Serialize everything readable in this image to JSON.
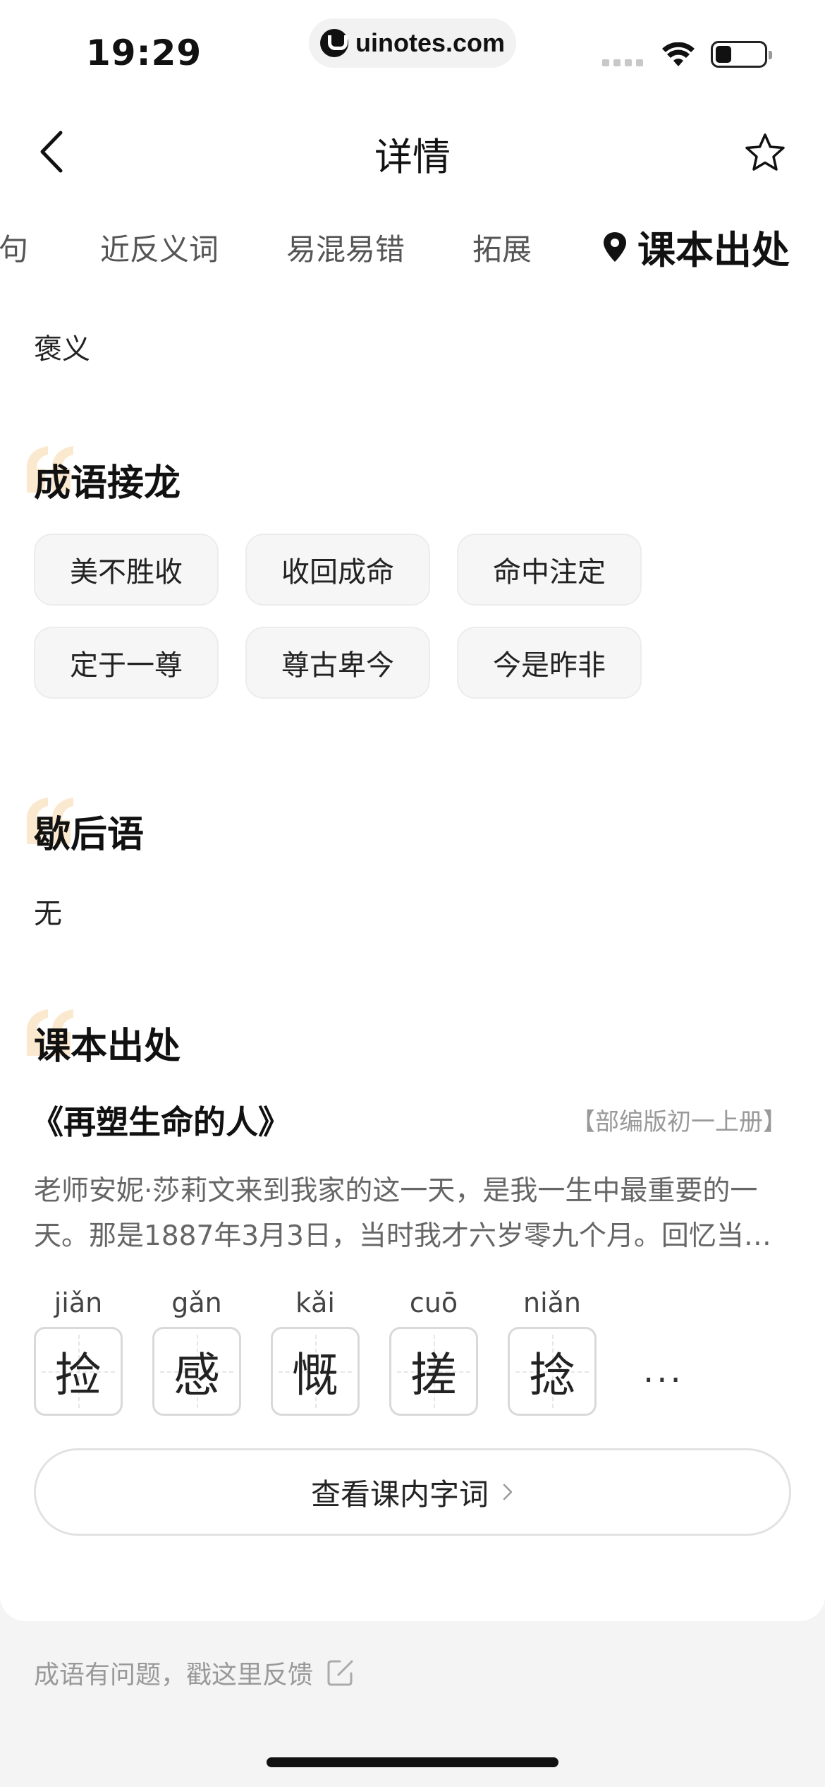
{
  "status_bar": {
    "time": "19:29",
    "url": "uinotes.com"
  },
  "header": {
    "title": "详情",
    "back_icon": "chevron-left-icon",
    "favorite_icon": "star-icon"
  },
  "tabs": [
    {
      "label": "句"
    },
    {
      "label": "近反义词"
    },
    {
      "label": "易混易错"
    },
    {
      "label": "拓展"
    },
    {
      "label": "课本出处",
      "active": true,
      "icon": "location-pin-icon"
    }
  ],
  "usage_value": "褒义",
  "idiom_chain": {
    "title": "成语接龙",
    "items": [
      "美不胜收",
      "收回成命",
      "命中注定",
      "定于一尊",
      "尊古卑今",
      "今是昨非"
    ]
  },
  "xiehouyu": {
    "title": "歇后语",
    "value": "无"
  },
  "textbook_source": {
    "title": "课本出处",
    "lesson_title": "《再塑生命的人》",
    "edition_tag": "【部编版初一上册】",
    "excerpt": "老师安妮·莎莉文来到我家的这一天，是我一生中最重要的一天。那是1887年3月3日，当时我才六岁零九个月。回忆当时的情景，仿佛就在眼前。",
    "characters": [
      {
        "pinyin": "jiǎn",
        "char": "捡"
      },
      {
        "pinyin": "gǎn",
        "char": "感"
      },
      {
        "pinyin": "kǎi",
        "char": "慨"
      },
      {
        "pinyin": "cuō",
        "char": "搓"
      },
      {
        "pinyin": "niǎn",
        "char": "捻"
      }
    ],
    "more": "···",
    "view_button": "查看课内字词"
  },
  "feedback": {
    "text": "成语有问题，戳这里反馈"
  },
  "colors": {
    "accent_deco": "#fbe9cf",
    "background": "#f4f4f4",
    "card": "#ffffff"
  }
}
